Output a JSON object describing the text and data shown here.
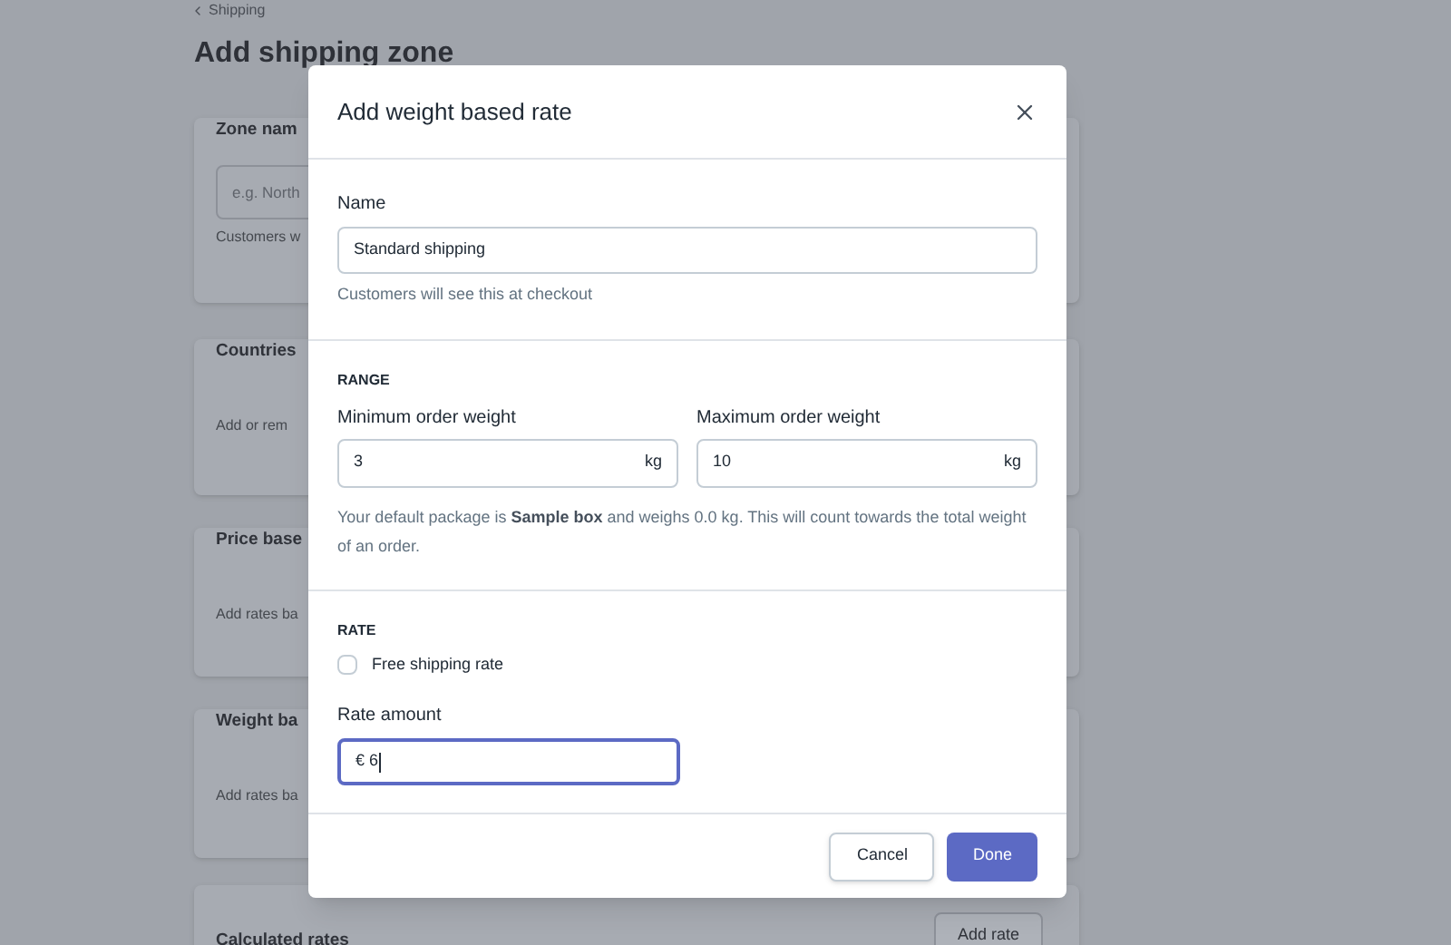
{
  "page": {
    "back_link": "Shipping",
    "title": "Add shipping zone",
    "cards": [
      {
        "kind": "field",
        "title": "Zone nam",
        "placeholder": "e.g. North",
        "help": "Customers w"
      },
      {
        "kind": "text",
        "title": "Countries",
        "text": "Add or rem"
      },
      {
        "kind": "text",
        "title": "Price base",
        "text": "Add rates ba"
      },
      {
        "kind": "text",
        "title": "Weight ba",
        "text": "Add rates ba"
      },
      {
        "kind": "button",
        "title": "Calculated rates",
        "button": "Add rate"
      }
    ]
  },
  "modal": {
    "title": "Add weight based rate",
    "name_field": {
      "label": "Name",
      "value": "Standard shipping",
      "help": "Customers will see this at checkout"
    },
    "range": {
      "heading": "RANGE",
      "fields": [
        {
          "label": "Minimum order weight",
          "value": "3",
          "unit": "kg"
        },
        {
          "label": "Maximum order weight",
          "value": "10",
          "unit": "kg"
        }
      ],
      "note": "Your default package is **Sample box** and weighs 0.0 kg. This will count towards the total weight of an order."
    },
    "rate": {
      "heading": "RATE",
      "free_shipping": {
        "label": "Free shipping rate",
        "checked": false
      },
      "amount": {
        "label": "Rate amount",
        "value": "€ 6",
        "focused": true
      }
    },
    "buttons": [
      {
        "label": "Cancel",
        "kind": "secondary"
      },
      {
        "label": "Done",
        "kind": "primary"
      }
    ]
  }
}
